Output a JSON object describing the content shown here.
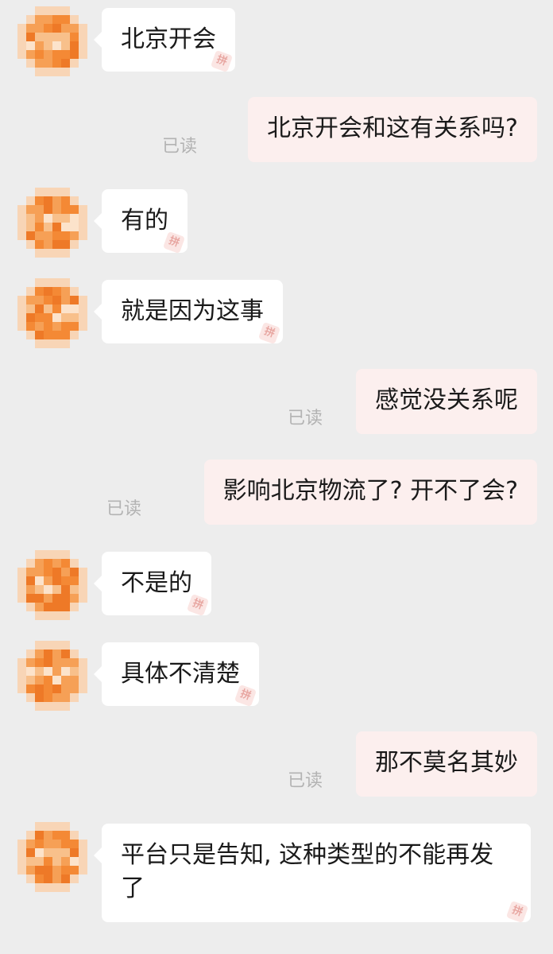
{
  "messages": [
    {
      "side": "in",
      "text": "北京开会",
      "stamp": "拼"
    },
    {
      "side": "out",
      "text": "北京开会和这有关系吗?",
      "status": "已读"
    },
    {
      "side": "in",
      "text": "有的",
      "stamp": "拼"
    },
    {
      "side": "in",
      "text": "就是因为这事",
      "stamp": "拼"
    },
    {
      "side": "out",
      "text": "感觉没关系呢",
      "status": "已读"
    },
    {
      "side": "out",
      "text": "影响北京物流了? 开不了会?",
      "status": "已读"
    },
    {
      "side": "in",
      "text": "不是的",
      "stamp": "拼"
    },
    {
      "side": "in",
      "text": "具体不清楚",
      "stamp": "拼"
    },
    {
      "side": "out",
      "text": "那不莫名其妙",
      "status": "已读"
    },
    {
      "side": "in",
      "text": "平台只是告知, 这种类型的不能再发了",
      "stamp": "拼"
    }
  ],
  "colors": {
    "background": "#ededed",
    "incoming_bubble": "#ffffff",
    "outgoing_bubble": "#fcefee",
    "avatar_palette": [
      "#f08a3a",
      "#f3a15a",
      "#e97a2c",
      "#f6c08e",
      "#fbe3cc",
      "#ee8f47"
    ]
  }
}
